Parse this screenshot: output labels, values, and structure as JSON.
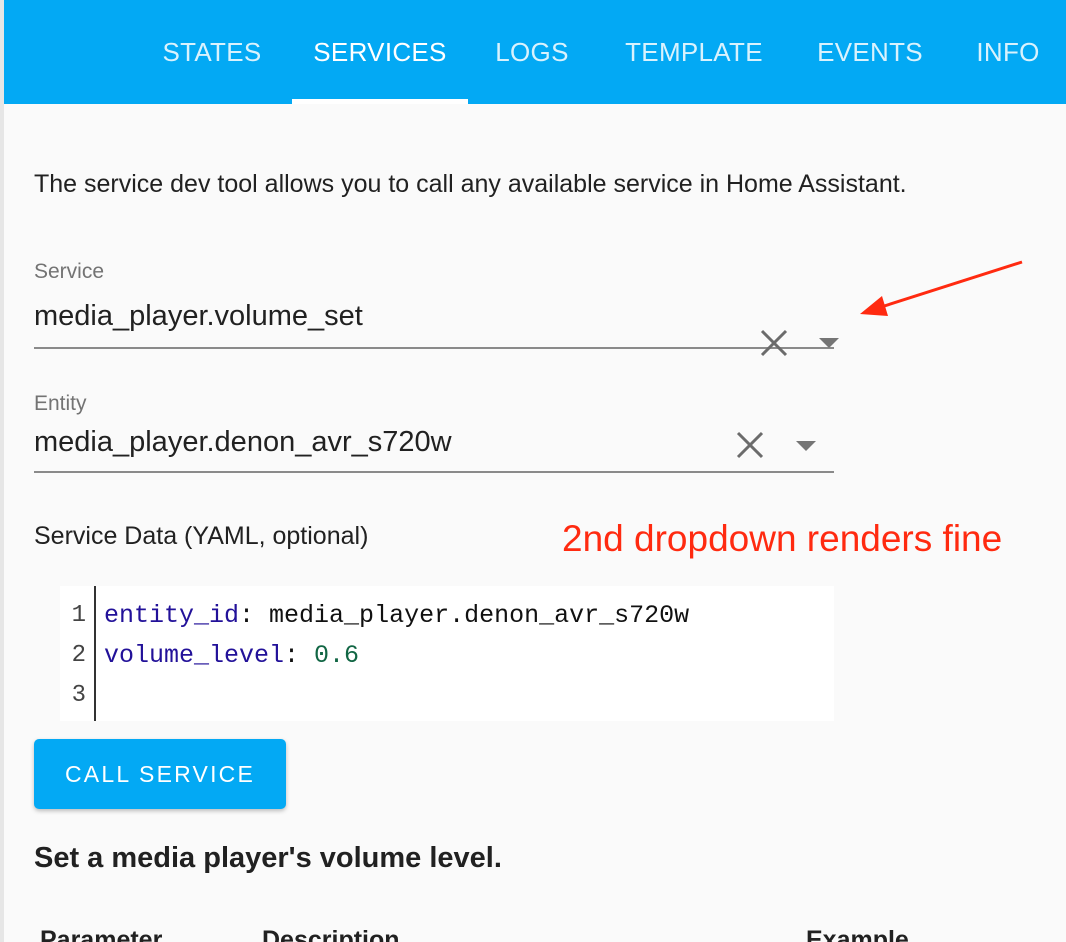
{
  "tabs": [
    {
      "label": "STATES"
    },
    {
      "label": "SERVICES",
      "active": true
    },
    {
      "label": "LOGS"
    },
    {
      "label": "TEMPLATE"
    },
    {
      "label": "EVENTS"
    },
    {
      "label": "INFO"
    }
  ],
  "description": "The service dev tool allows you to call any available service in Home Assistant.",
  "service_field": {
    "label": "Service",
    "value": "media_player.volume_set"
  },
  "entity_field": {
    "label": "Entity",
    "value": "media_player.denon_avr_s720w"
  },
  "annotation": "2nd dropdown renders fine",
  "yaml_label": "Service Data (YAML, optional)",
  "editor": {
    "line_numbers": [
      "1",
      "2",
      "3"
    ],
    "lines": [
      {
        "key": "entity_id",
        "sep": ": ",
        "value": "media_player.denon_avr_s720w"
      },
      {
        "key": "volume_level",
        "sep": ": ",
        "value": "0.6"
      }
    ]
  },
  "call_button": "CALL SERVICE",
  "service_description": "Set a media player's volume level.",
  "table_headers": [
    "Parameter",
    "Description",
    "Example"
  ],
  "colors": {
    "primary": "#03a9f4",
    "annotation": "#ff2a10",
    "yaml_key": "#221199",
    "yaml_number": "#116644"
  },
  "icons": [
    "close-icon",
    "arrow-drop-down-icon",
    "annotation-arrow"
  ]
}
